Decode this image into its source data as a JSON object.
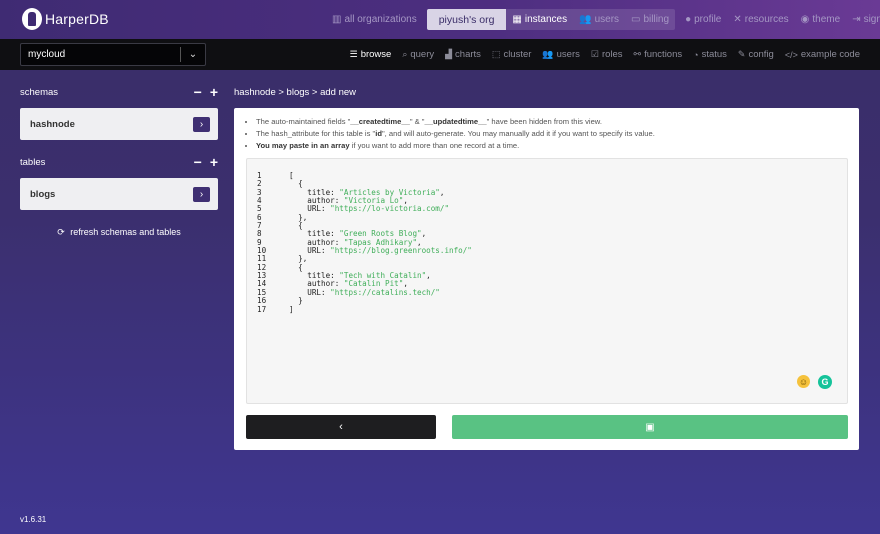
{
  "app": {
    "logo_text": "HarperDB",
    "version": "v1.6.31"
  },
  "topnav": {
    "all_orgs": "all organizations",
    "org_name": "piyush's org",
    "instances": "instances",
    "users": "users",
    "billing": "billing",
    "profile": "profile",
    "resources": "resources",
    "theme": "theme",
    "sign_out": "sign out"
  },
  "instance_select": {
    "value": "mycloud"
  },
  "subnav": {
    "browse": "browse",
    "query": "query",
    "charts": "charts",
    "cluster": "cluster",
    "users": "users",
    "roles": "roles",
    "functions": "functions",
    "status": "status",
    "config": "config",
    "example_code": "example code"
  },
  "sidebar": {
    "schemas_label": "schemas",
    "schema_item": "hashnode",
    "tables_label": "tables",
    "table_item": "blogs",
    "refresh_label": "refresh schemas and tables"
  },
  "breadcrumb": "hashnode > blogs > add new",
  "notes": {
    "n1_pre": "The auto-maintained fields \"",
    "n1_f1": "__createdtime__",
    "n1_mid": "\" & \"",
    "n1_f2": "__updatedtime__",
    "n1_post": "\" have been hidden from this view.",
    "n2_pre": "The hash_attribute for this table is \"",
    "n2_attr": "id",
    "n2_post": "\", and will auto-generate. You may manually add it if you want to specify its value.",
    "n3_bold": "You may paste in an array",
    "n3_post": " if you want to add more than one record at a time."
  },
  "editor": {
    "lines": [
      {
        "n": "1",
        "pre": "[",
        "str": "",
        "post": ""
      },
      {
        "n": "2",
        "pre": "  {",
        "str": "",
        "post": ""
      },
      {
        "n": "3",
        "pre": "    title: ",
        "str": "\"Articles by Victoria\"",
        "post": ","
      },
      {
        "n": "4",
        "pre": "    author: ",
        "str": "\"Victoria Lo\"",
        "post": ","
      },
      {
        "n": "5",
        "pre": "    URL: ",
        "str": "\"https://lo-victoria.com/\"",
        "post": ""
      },
      {
        "n": "6",
        "pre": "  },",
        "str": "",
        "post": ""
      },
      {
        "n": "7",
        "pre": "  {",
        "str": "",
        "post": ""
      },
      {
        "n": "8",
        "pre": "    title: ",
        "str": "\"Green Roots Blog\"",
        "post": ","
      },
      {
        "n": "9",
        "pre": "    author: ",
        "str": "\"Tapas Adhikary\"",
        "post": ","
      },
      {
        "n": "10",
        "pre": "    URL: ",
        "str": "\"https://blog.greenroots.info/\"",
        "post": ""
      },
      {
        "n": "11",
        "pre": "  },",
        "str": "",
        "post": ""
      },
      {
        "n": "12",
        "pre": "  {",
        "str": "",
        "post": ""
      },
      {
        "n": "13",
        "pre": "    title: ",
        "str": "\"Tech with Catalin\"",
        "post": ","
      },
      {
        "n": "14",
        "pre": "    author: ",
        "str": "\"Catalin Pit\"",
        "post": ","
      },
      {
        "n": "15",
        "pre": "    URL: ",
        "str": "\"https://catalins.tech/\"",
        "post": ""
      },
      {
        "n": "16",
        "pre": "  }",
        "str": "",
        "post": ""
      },
      {
        "n": "17",
        "pre": "]",
        "str": "",
        "post": ""
      }
    ]
  },
  "colors": {
    "brand_purple": "#3f2b73",
    "save_green": "#59c283",
    "code_string": "#3fae59"
  }
}
